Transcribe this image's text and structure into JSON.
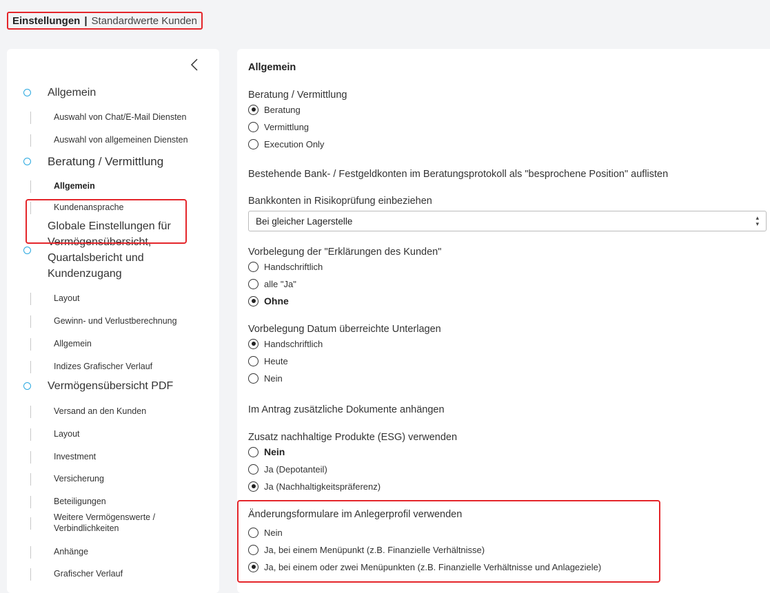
{
  "header": {
    "title": "Einstellungen",
    "separator": "|",
    "subtitle": "Standardwerte Kunden"
  },
  "sidebar": {
    "collapse_icon": "chevron-left-icon",
    "sections": [
      {
        "label": "Allgemein",
        "items": [
          "Auswahl von Chat/E-Mail Diensten",
          "Auswahl von allgemeinen Diensten"
        ]
      },
      {
        "label": "Beratung / Vermittlung",
        "items": [
          "Allgemein",
          "Kundenansprache"
        ]
      },
      {
        "label_lines": [
          "Globale Einstellungen für",
          "Vermögensübersicht,",
          "Quartalsbericht und",
          "Kundenzugang"
        ],
        "items": [
          "Layout",
          "Gewinn- und Verlustberechnung",
          "Allgemein",
          "Indizes Grafischer Verlauf"
        ]
      },
      {
        "label": "Vermögensübersicht PDF",
        "items": [
          "Versand an den Kunden",
          "Layout",
          "Investment",
          "Versicherung",
          "Beteiligungen",
          "Weitere Vermögenswerte /",
          "Verbindlichkeiten",
          "Anhänge",
          "Grafischer Verlauf"
        ]
      }
    ]
  },
  "main": {
    "title": "Allgemein",
    "groups": [
      {
        "label": "Beratung / Vermittlung",
        "options": [
          "Beratung",
          "Vermittlung",
          "Execution Only"
        ],
        "selected": 0
      },
      {
        "label": "Bestehende Bank- / Festgeldkonten im Beratungsprotokoll als \"besprochene Position\" auflisten"
      },
      {
        "label": "Bankkonten in Risikoprüfung einbeziehen",
        "select_value": "Bei gleicher Lagerstelle"
      },
      {
        "label": "Vorbelegung der \"Erklärungen des Kunden\"",
        "options": [
          "Handschriftlich",
          "alle \"Ja\"",
          "Ohne"
        ],
        "selected": 2
      },
      {
        "label": "Vorbelegung Datum überreichte Unterlagen",
        "options": [
          "Handschriftlich",
          "Heute",
          "Nein"
        ],
        "selected": 0
      },
      {
        "label": "Im Antrag zusätzliche Dokumente anhängen"
      },
      {
        "label": "Zusatz nachhaltige Produkte (ESG) verwenden",
        "options": [
          "Nein",
          "Ja (Depotanteil)",
          "Ja (Nachhaltigkeitspräferenz)"
        ],
        "selected": 2
      },
      {
        "label": "Änderungsformulare im Anlegerprofil verwenden",
        "options": [
          "Nein",
          "Ja, bei einem Menüpunkt (z.B. Finanzielle Verhältnisse)",
          "Ja, bei einem oder zwei Menüpunkten (z.B. Finanzielle Verhältnisse und Anlageziele)"
        ],
        "selected": 2
      }
    ]
  },
  "colors": {
    "highlight": "#e4252a",
    "bullet": "#29a8e0"
  }
}
